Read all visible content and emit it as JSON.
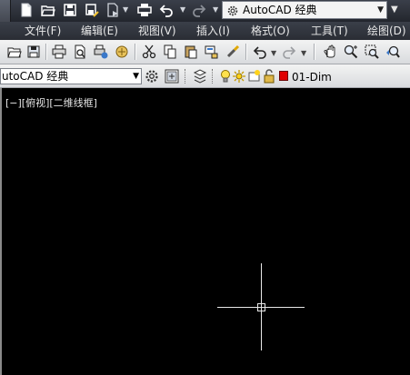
{
  "quick_access": {
    "icons": [
      "new-icon",
      "open-icon",
      "save-icon",
      "saveas-icon",
      "publish-icon",
      "plot-icon",
      "undo-icon",
      "redo-icon"
    ],
    "workspace": {
      "selected": "AutoCAD 经典"
    }
  },
  "menubar": {
    "items": [
      {
        "label": "文件(F)"
      },
      {
        "label": "编辑(E)"
      },
      {
        "label": "视图(V)"
      },
      {
        "label": "插入(I)"
      },
      {
        "label": "格式(O)"
      },
      {
        "label": "工具(T)"
      },
      {
        "label": "绘图(D)"
      }
    ]
  },
  "standard_toolbar": {
    "icons": [
      "open-icon",
      "save-icon",
      "plot-icon",
      "plot-preview-icon",
      "publish-icon",
      "3d-print-icon",
      "cut-icon",
      "copy-icon",
      "paste-icon",
      "match-properties-icon",
      "brush-icon",
      "undo-icon",
      "redo-icon",
      "pan-icon",
      "zoom-realtime-icon",
      "zoom-window-icon",
      "zoom-previous-icon"
    ]
  },
  "workspaces_toolbar": {
    "selected": "utoCAD 经典"
  },
  "layers_toolbar": {
    "current_layer": "01-Dim",
    "layer_color": "#e00000"
  },
  "viewport": {
    "label": "[−][俯视][二维线框]",
    "background": "#000000"
  },
  "colors": {
    "title_bar": "#2c2f36",
    "toolbar": "#e4e5e7",
    "crosshair": "#e8e8e8"
  }
}
